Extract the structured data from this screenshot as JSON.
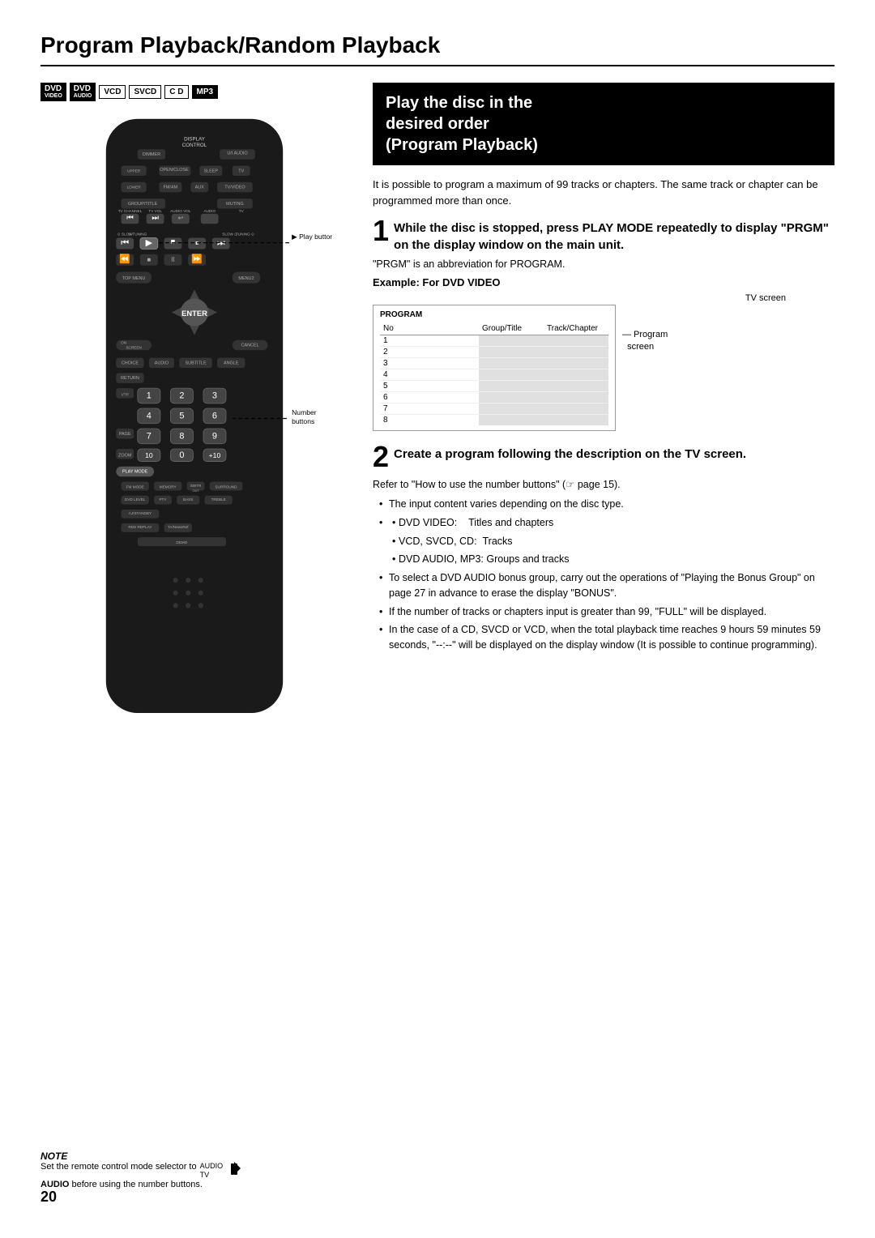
{
  "page": {
    "number": "20",
    "title": "Program Playback/Random Playback"
  },
  "badges": [
    {
      "label": "DVD",
      "sub": "VIDEO",
      "type": "dual-black"
    },
    {
      "label": "DVD",
      "sub": "AUDIO",
      "type": "dual-black"
    },
    {
      "label": "VCD",
      "type": "outline"
    },
    {
      "label": "SVCD",
      "type": "outline"
    },
    {
      "label": "C D",
      "type": "outline"
    },
    {
      "label": "MP3",
      "type": "black"
    }
  ],
  "section_header": {
    "line1": "Play the disc in the",
    "line2": "desired order",
    "line3": "(Program Playback)"
  },
  "intro_text": "It is possible to program a maximum of 99 tracks or chapters. The same track or chapter can be programmed more than once.",
  "step1": {
    "number": "1",
    "text": "While the disc is stopped, press PLAY MODE repeatedly to display “PRGM” on the display window on the main unit.",
    "note": "“PRGM” is an abbreviation for PROGRAM.",
    "example_label": "Example: For DVD VIDEO",
    "tv_screen_label": "TV screen",
    "program_label": "PROGRAM",
    "table_headers": [
      "No",
      "Group/Title",
      "Track/Chapter"
    ],
    "table_rows": [
      "1",
      "2",
      "3",
      "4",
      "5",
      "6",
      "7",
      "8"
    ],
    "program_screen_note": "Program\nscreen"
  },
  "step2": {
    "number": "2",
    "text": "Create a program following the description on the TV screen.",
    "refer_text": "Refer to “How to use the number buttons” (☆ page 15).",
    "bullets": [
      "The input content varies depending on the disc type.",
      "DVD VIDEO:    Titles and chapters",
      "VCD, SVCD, CD:   Tracks",
      "DVD AUDIO, MP3: Groups and tracks",
      "To select a DVD AUDIO bonus group, carry out the operations of “Playing the Bonus Group” on page 27 in advance to erase the display “BONUS”.",
      "If the number of tracks or chapters input is greater than 99, “FULL” will be displayed.",
      "In the case of a CD, SVCD or VCD, when the total playback time reaches 9 hours 59 minutes 59 seconds, “--:--” will be displayed on the display window (It is possible to continue programming)."
    ]
  },
  "callouts": {
    "play_button": "► Play button",
    "number_buttons": "Number\nbuttons"
  },
  "note": {
    "title": "NOTE",
    "text1": "Set the remote control mode selector to",
    "text2": "AUDIO",
    "text3": "before using the number buttons.",
    "icon": "AUDIO\nTV"
  },
  "remote": {
    "choice_label": "CHOICE"
  }
}
